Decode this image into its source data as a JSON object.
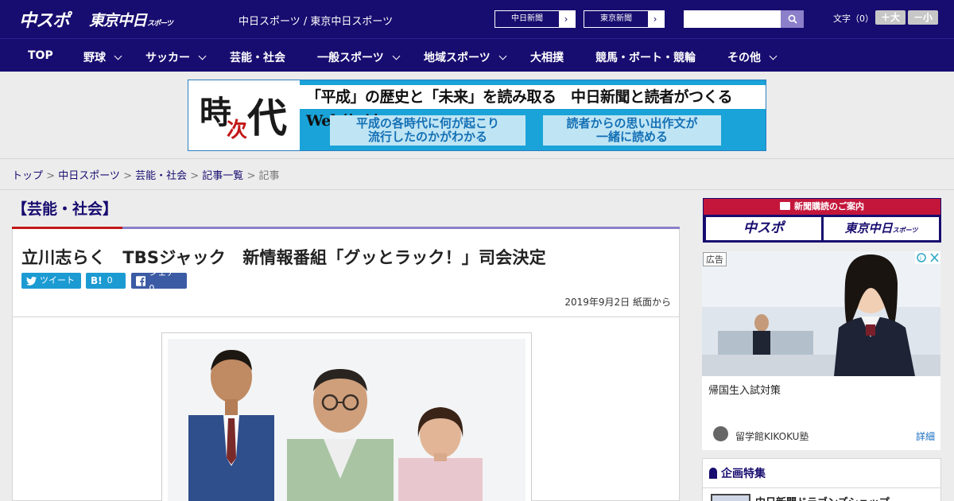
{
  "header": {
    "logo_chuspo": "中スポ",
    "logo_tokyo": "東京中日",
    "logo_tokyo_small": "スポーツ",
    "site_links": "中日スポーツ / 東京中日スポーツ",
    "paper_buttons": [
      "中日新聞",
      "東京新聞"
    ],
    "search_placeholder": "",
    "text_size_label": "文字（0）",
    "text_size_big": "＋大",
    "text_size_small": "－小"
  },
  "nav": {
    "items": [
      {
        "label": "TOP"
      },
      {
        "label": "野球"
      },
      {
        "label": "サッカー"
      },
      {
        "label": "芸能・社会"
      },
      {
        "label": "一般スポーツ"
      },
      {
        "label": "地域スポーツ"
      },
      {
        "label": "大相撲"
      },
      {
        "label": "競馬・ボート・競輪"
      },
      {
        "label": "その他"
      }
    ]
  },
  "banner": {
    "k1": "時",
    "k2": "次",
    "k3": "代",
    "headline": "「平成」の歴史と「未来」を読み取る　中日新聞と読者がつくるWebサイト",
    "sub1_line1": "平成の各時代に何が起こり",
    "sub1_line2": "流行したのかがわかる",
    "sub2_line1": "読者からの思い出作文が",
    "sub2_line2": "一緒に読める"
  },
  "breadcrumb": {
    "items": [
      "トップ",
      "中日スポーツ",
      "芸能・社会",
      "記事一覧"
    ],
    "current": "記事",
    "separator": " > "
  },
  "article": {
    "category": "【芸能・社会】",
    "title": "立川志らく　TBSジャック　新情報番組「グッとラック！」司会決定",
    "share_tweet": "ツイート",
    "share_hatena": "0",
    "share_facebook": "シェア 0",
    "hatena_mark": "B!",
    "date": "2019年9月2日 紙面から"
  },
  "sidebar": {
    "subs_head": "新聞購読のご案内",
    "subs_logo1": "中スポ",
    "subs_logo2": "東京中日",
    "subs_logo2_small": "スポーツ",
    "ad_tag": "広告",
    "ad_title": "帰国生入試対策",
    "ad_advertiser": "留学館KIKOKU塾",
    "ad_detail": "詳細",
    "feature_head": "企画特集",
    "feature_item": "中日新聞ドラゴンズショップ"
  },
  "colors": {
    "brand_navy": "#170c6f",
    "accent_red": "#c31818",
    "accent_purple": "#8b80c9",
    "twitter": "#1c9bd3",
    "facebook": "#3b5ba4"
  }
}
